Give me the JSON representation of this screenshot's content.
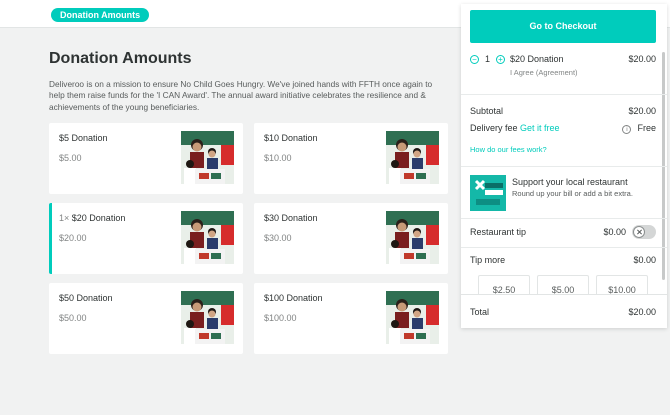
{
  "header": {
    "pill_label": "Donation Amounts"
  },
  "main": {
    "heading": "Donation Amounts",
    "intro": "Deliveroo is on a mission to ensure No Child Goes Hungry. We've joined hands with FFTH once again to help them raise funds for the 'I CAN Award'. The annual award initiative celebrates the resilience and & achievements of the young beneficiaries.",
    "cards": [
      {
        "title": "$5 Donation",
        "price": "$5.00",
        "qty": ""
      },
      {
        "title": "$10 Donation",
        "price": "$10.00",
        "qty": ""
      },
      {
        "title": "$20 Donation",
        "price": "$20.00",
        "qty": "1×"
      },
      {
        "title": "$30 Donation",
        "price": "$30.00",
        "qty": ""
      },
      {
        "title": "$50 Donation",
        "price": "$50.00",
        "qty": ""
      },
      {
        "title": "$100 Donation",
        "price": "$100.00",
        "qty": ""
      }
    ]
  },
  "basket": {
    "checkout_label": "Go to Checkout",
    "item": {
      "minus": "−",
      "plus": "+",
      "qty": "1",
      "name": "$20 Donation",
      "sub": "I Agree (Agreement)",
      "price": "$20.00"
    },
    "subtotal_label": "Subtotal",
    "subtotal_value": "$20.00",
    "delivery_label": "Delivery fee",
    "delivery_link": "Get it free",
    "delivery_value": "Free",
    "info_glyph": "i",
    "fees_link": "How do our fees work?",
    "support_title": "Support your local restaurant",
    "support_sub": "Round up your bill or add a bit extra.",
    "tip_label": "Restaurant tip",
    "tip_value": "$0.00",
    "tip_more_label": "Tip more",
    "tip_more_value": "$0.00",
    "tip_options": [
      "$2.50",
      "$5.00",
      "$10.00"
    ],
    "total_label": "Total",
    "total_value": "$20.00"
  },
  "colors": {
    "accent": "#00ccbc",
    "text": "#2e3333",
    "muted": "#828585",
    "background": "#f1f2f2"
  }
}
